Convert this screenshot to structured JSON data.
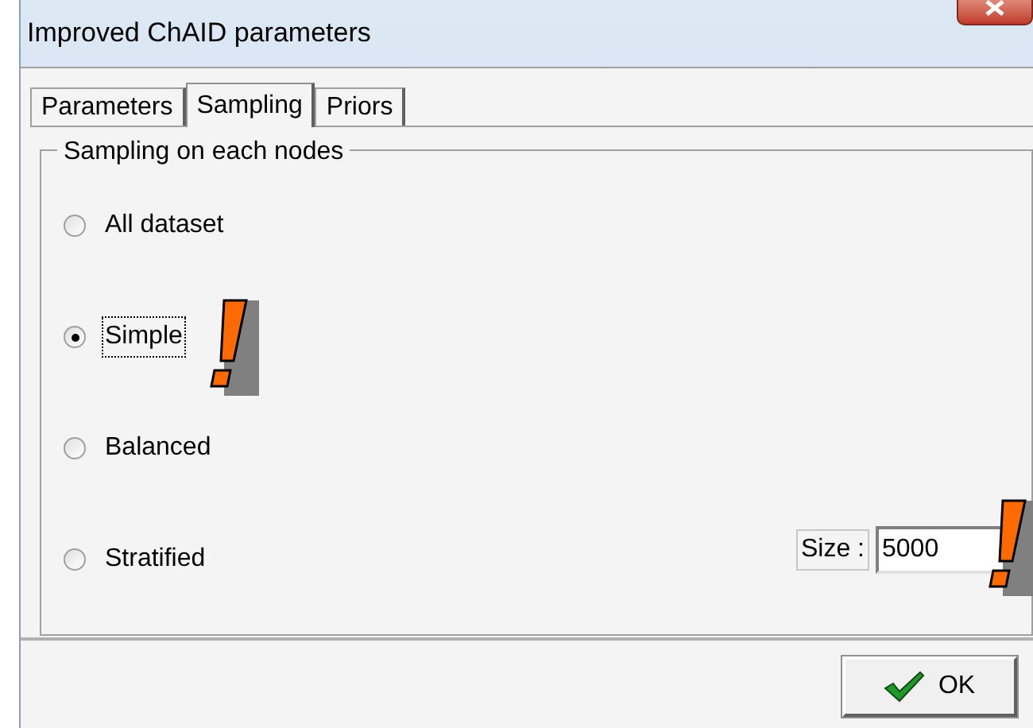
{
  "window": {
    "title": "Improved ChAID parameters"
  },
  "tabs": [
    {
      "label": "Parameters",
      "selected": false
    },
    {
      "label": "Sampling",
      "selected": true
    },
    {
      "label": "Priors",
      "selected": false
    }
  ],
  "group": {
    "title": "Sampling on each nodes"
  },
  "options": [
    {
      "label": "All dataset",
      "selected": false,
      "focused": false,
      "flagged": false
    },
    {
      "label": "Simple",
      "selected": true,
      "focused": true,
      "flagged": true
    },
    {
      "label": "Balanced",
      "selected": false,
      "focused": false,
      "flagged": false
    },
    {
      "label": "Stratified",
      "selected": false,
      "focused": false,
      "flagged": false
    }
  ],
  "size": {
    "label": "Size :",
    "value": "5000",
    "flagged": true
  },
  "buttons": [
    {
      "label": "OK"
    }
  ]
}
